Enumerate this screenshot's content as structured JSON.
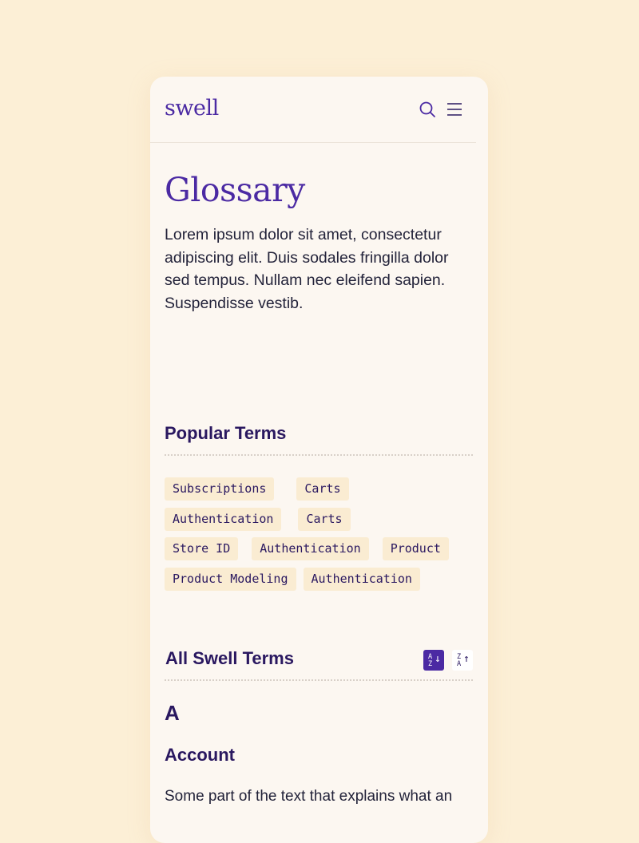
{
  "header": {
    "logo": "swell"
  },
  "page": {
    "title": "Glossary",
    "intro": "Lorem ipsum dolor sit amet, consectetur adipiscing elit. Duis sodales fringilla dolor sed tempus. Nullam nec eleifend sapien. Suspendisse vestib."
  },
  "popular": {
    "heading": "Popular Terms",
    "rows": [
      [
        "Subscriptions",
        "Carts"
      ],
      [
        "Authentication",
        "Carts"
      ],
      [
        "Store ID",
        "Authentication",
        "Product"
      ],
      [
        "Product Modeling",
        "Authentication"
      ]
    ]
  },
  "all_terms": {
    "heading": "All Swell Terms",
    "sort_az": {
      "top": "A",
      "bottom": "Z",
      "arrow": "↓"
    },
    "sort_za": {
      "top": "Z",
      "bottom": "A",
      "arrow": "↑"
    },
    "letter": "A",
    "term": "Account",
    "description": "Some part of the text that explains what an"
  },
  "colors": {
    "brand": "#4b2aa3",
    "heading": "#2a1860",
    "background": "#fcefd6",
    "card": "#fcf7f1",
    "tag": "#faecd2"
  },
  "icons": {
    "search": "search-icon",
    "menu": "menu-icon"
  }
}
